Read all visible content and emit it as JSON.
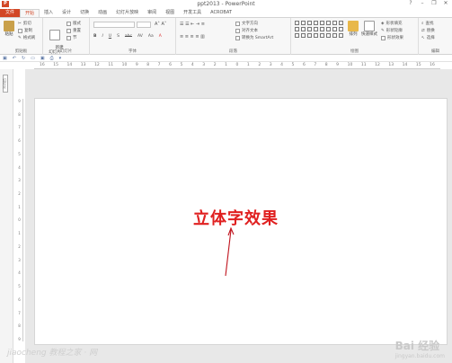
{
  "window": {
    "title": "ppt2013 - PowerPoint",
    "logo": "P",
    "help": "?",
    "minimize": "–",
    "restore": "❐",
    "close": "✕"
  },
  "tabs": [
    "文件",
    "开始",
    "插入",
    "设计",
    "切换",
    "动画",
    "幻灯片放映",
    "审阅",
    "视图",
    "开发工具",
    "ACROBAT"
  ],
  "clipboard": {
    "label": "剪贴板",
    "paste": "粘贴",
    "cut": "剪切",
    "copy": "复制",
    "format_painter": "格式刷"
  },
  "slides": {
    "label": "幻灯片",
    "new_slide": "新建\n幻灯片",
    "layout": "版式",
    "reset": "重置",
    "section": "节"
  },
  "font": {
    "label": "字体",
    "format_buttons": [
      "B",
      "I",
      "U",
      "S",
      "abc",
      "AV",
      "Aa",
      "A"
    ]
  },
  "paragraph": {
    "label": "段落",
    "text_direction": "文字方向",
    "align_text": "对齐文本",
    "smartart": "转换为 SmartArt"
  },
  "drawing": {
    "label": "绘图",
    "arrange": "排列",
    "quick_styles": "快速样式",
    "shape_fill": "形状填充",
    "shape_outline": "形状轮廓",
    "shape_effects": "形状效果"
  },
  "editing": {
    "label": "编辑",
    "find": "查找",
    "replace": "替换",
    "select": "选择"
  },
  "ruler": {
    "marks": [
      "16",
      "15",
      "14",
      "13",
      "12",
      "11",
      "10",
      "9",
      "8",
      "7",
      "6",
      "5",
      "4",
      "3",
      "2",
      "1",
      "0",
      "1",
      "2",
      "3",
      "4",
      "5",
      "6",
      "7",
      "8",
      "9",
      "10",
      "11",
      "12",
      "13",
      "14",
      "15",
      "16"
    ]
  },
  "vruler": {
    "marks": [
      "9",
      "8",
      "7",
      "6",
      "5",
      "4",
      "3",
      "2",
      "1",
      "0",
      "1",
      "2",
      "3",
      "4",
      "5",
      "6",
      "7",
      "8",
      "9"
    ]
  },
  "outline": {
    "label": "幻灯片"
  },
  "slide": {
    "text": "立体字效果",
    "text_color": "#e02020"
  },
  "watermark": {
    "brand": "Bai 经验",
    "sub": "jingyan.baidu.com"
  },
  "footer_wm": {
    "text": "jiaocheng 教程之家 · 网"
  }
}
